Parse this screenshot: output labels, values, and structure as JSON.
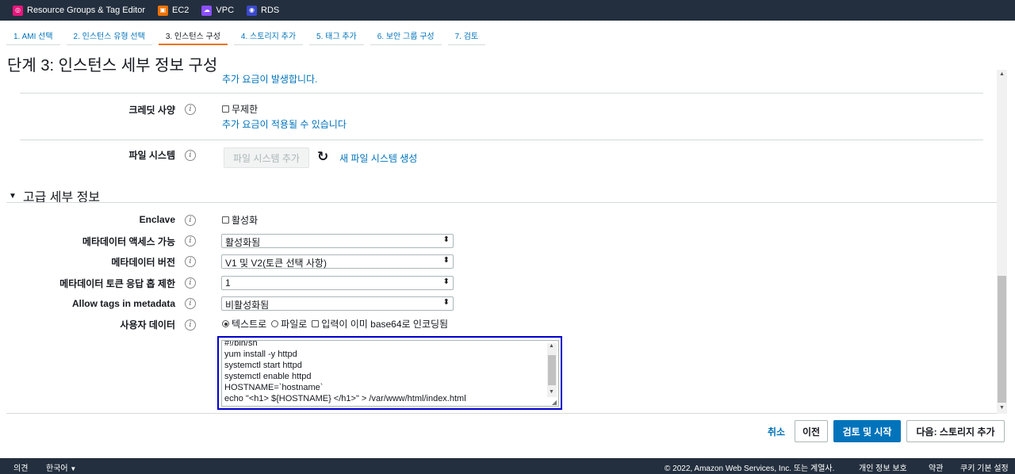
{
  "topbar": {
    "favorites": [
      {
        "label": "Resource Groups & Tag Editor",
        "icon": "resource-groups-icon"
      },
      {
        "label": "EC2",
        "icon": "ec2-icon"
      },
      {
        "label": "VPC",
        "icon": "vpc-icon"
      },
      {
        "label": "RDS",
        "icon": "rds-icon"
      }
    ]
  },
  "wizard": {
    "steps": [
      "1. AMI 선택",
      "2. 인스턴스 유형 선택",
      "3. 인스턴스 구성",
      "4. 스토리지 추가",
      "5. 태그 추가",
      "6. 보안 그룹 구성",
      "7. 검토"
    ],
    "active_step": 2
  },
  "page_title": "단계 3: 인스턴스 세부 정보 구성",
  "form": {
    "top_note": "추가 요금이 발생합니다.",
    "credit": {
      "label": "크레딧 사양",
      "checkbox_label": "무제한",
      "note": "추가 요금이 적용될 수 있습니다"
    },
    "filesystem": {
      "label": "파일 시스템",
      "add_button": "파일 시스템 추가",
      "create_link": "새 파일 시스템 생성"
    },
    "advanced": {
      "heading": "고급 세부 정보",
      "enclave": {
        "label": "Enclave",
        "checkbox_label": "활성화"
      },
      "metadata_access": {
        "label": "메타데이터 액세스 가능",
        "value": "활성화됨"
      },
      "metadata_version": {
        "label": "메타데이터 버전",
        "value": "V1 및 V2(토큰 선택 사항)"
      },
      "metadata_hop": {
        "label": "메타데이터 토큰 응답 홉 제한",
        "value": "1"
      },
      "allow_tags": {
        "label": "Allow tags in metadata",
        "value": "비활성화됨"
      },
      "user_data": {
        "label": "사용자 데이터",
        "opt_text": "텍스트로",
        "opt_file": "파일로",
        "opt_base64": "입력이 이미 base64로 인코딩됨",
        "lines": [
          "#!/bin/sh",
          "yum install -y httpd",
          "systemctl start httpd",
          "systemctl enable httpd",
          "HOSTNAME=`hostname`",
          "echo \"<h1> ${HOSTNAME} </h1>\" > /var/www/html/index.html"
        ]
      }
    }
  },
  "actions": {
    "cancel": "취소",
    "previous": "이전",
    "review_launch": "검토 및 시작",
    "next": "다음: 스토리지 추가"
  },
  "footer": {
    "feedback": "의견",
    "language": "한국어",
    "copyright": "© 2022, Amazon Web Services, Inc. 또는 계열사.",
    "privacy": "개인 정보 보호",
    "terms": "약관",
    "cookie": "쿠키 기본 설정"
  }
}
